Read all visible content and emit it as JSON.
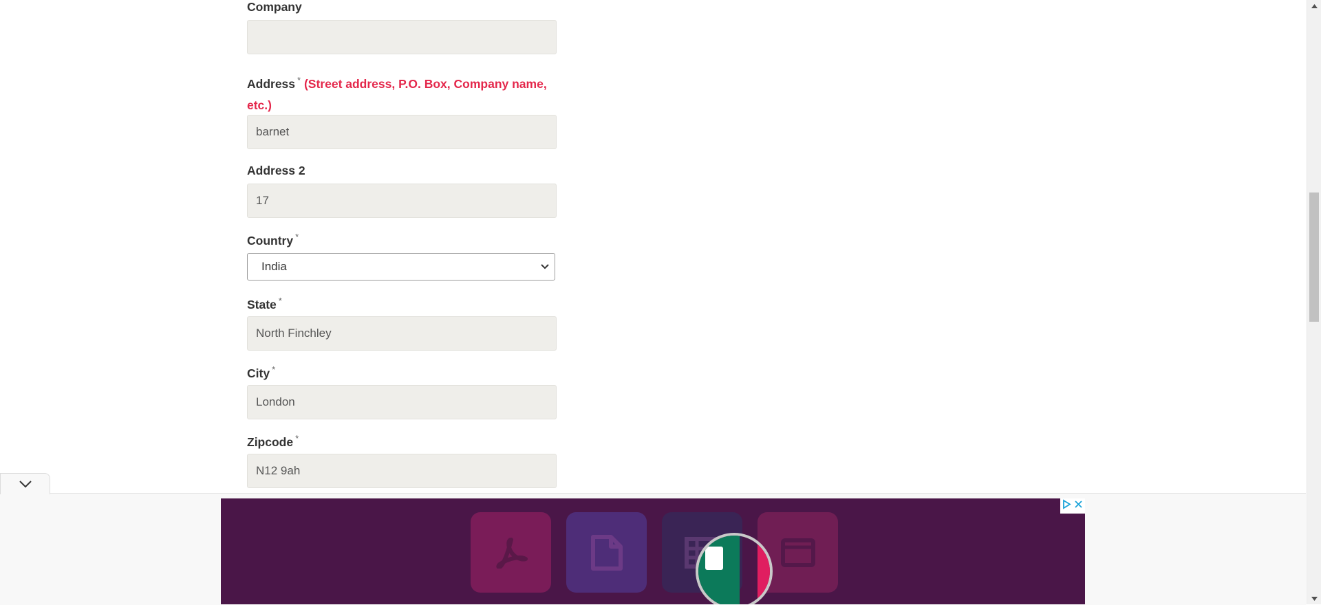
{
  "form": {
    "company": {
      "label": "Company",
      "value": ""
    },
    "address": {
      "label": "Address",
      "required_mark": "*",
      "note": "(Street address, P.O. Box, Company name, etc.)",
      "value": "barnet"
    },
    "address2": {
      "label": "Address 2",
      "value": "17"
    },
    "country": {
      "label": "Country",
      "required_mark": "*",
      "selected": "India"
    },
    "state": {
      "label": "State",
      "required_mark": "*",
      "value": "North Finchley"
    },
    "city": {
      "label": "City",
      "required_mark": "*",
      "value": "London"
    },
    "zipcode": {
      "label": "Zipcode",
      "required_mark": "*",
      "value": "N12 9ah"
    }
  },
  "ad": {
    "background": "#4a1648",
    "tiles": [
      "pdf-icon",
      "file-icon",
      "table-icon",
      "window-icon"
    ],
    "controls": [
      "adchoices-icon",
      "close-icon"
    ]
  },
  "colors": {
    "accent_red": "#e4274b",
    "field_bg": "#efeeea"
  }
}
